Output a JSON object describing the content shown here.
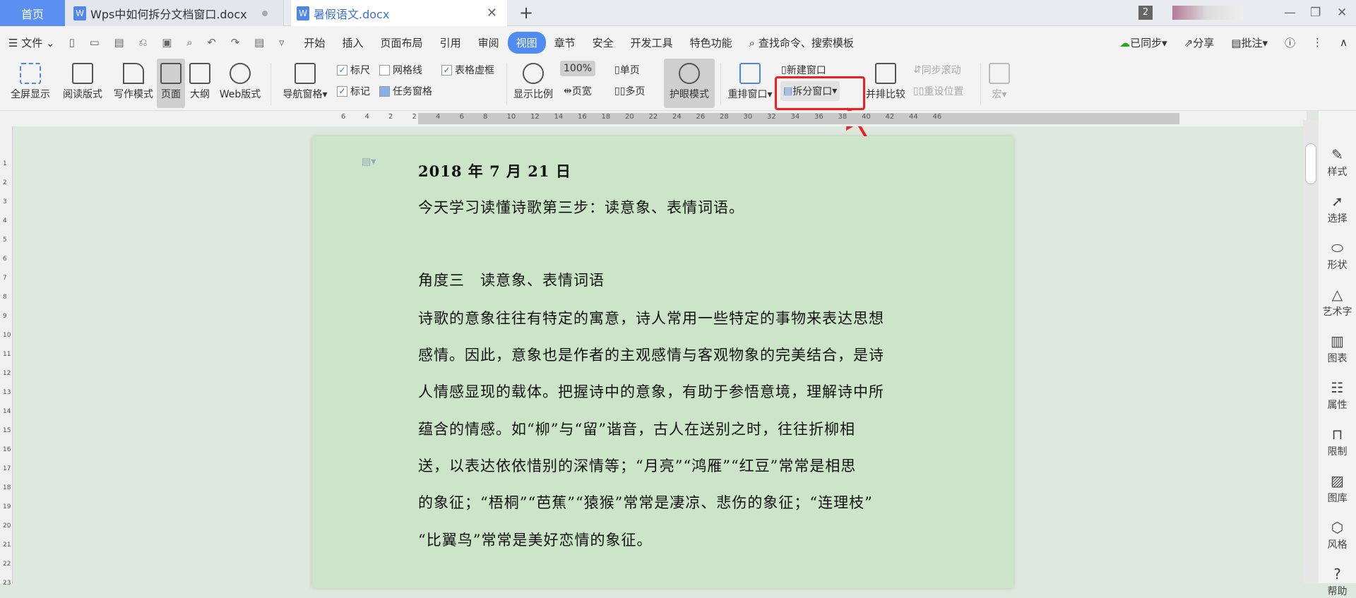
{
  "tabs": {
    "home": "首页",
    "doc1": "Wps中如何拆分文档窗口.docx",
    "doc2": "暑假语文.docx",
    "badge": "2"
  },
  "menu": {
    "file": "文件",
    "items": [
      "开始",
      "插入",
      "页面布局",
      "引用",
      "审阅",
      "视图",
      "章节",
      "安全",
      "开发工具",
      "特色功能"
    ],
    "active": "视图",
    "search": "查找命令、搜索模板",
    "sync": "已同步",
    "share": "分享",
    "comment": "批注"
  },
  "ribbon": {
    "fullscreen": "全屏显示",
    "read": "阅读版式",
    "write": "写作模式",
    "page": "页面",
    "outline": "大纲",
    "web": "Web版式",
    "nav": "导航窗格",
    "ruler": "标尺",
    "grid": "网格线",
    "tableframe": "表格虚框",
    "mark": "标记",
    "taskpane": "任务窗格",
    "zoom": "显示比例",
    "zoom_value": "100%",
    "single": "单页",
    "width": "页宽",
    "multi": "多页",
    "eye": "护眼模式",
    "rearrange": "重排窗口",
    "newwin": "新建窗口",
    "split": "拆分窗口",
    "compare": "并排比较",
    "syncscroll": "同步滚动",
    "resetpos": "重设位置",
    "macro": "宏"
  },
  "ruler_ticks": [
    "6",
    "4",
    "2",
    "2",
    "4",
    "6",
    "8",
    "10",
    "12",
    "14",
    "16",
    "18",
    "20",
    "22",
    "24",
    "26",
    "28",
    "30",
    "32",
    "34",
    "36",
    "38",
    "40",
    "42",
    "44",
    "46"
  ],
  "vruler_ticks": [
    "1",
    "2",
    "3",
    "4",
    "5",
    "6",
    "7",
    "8",
    "9",
    "10",
    "11",
    "12",
    "13",
    "14",
    "15",
    "16",
    "17",
    "18",
    "19",
    "20",
    "21",
    "22",
    "23"
  ],
  "document": {
    "lines": [
      "2018 年 7 月 21 日",
      "今天学习读懂诗歌第三步：读意象、表情词语。",
      "角度三　读意象、表情词语",
      "诗歌的意象往往有特定的寓意，诗人常用一些特定的事物来表达思想",
      "感情。因此，意象也是作者的主观感情与客观物象的完美结合，是诗",
      "人情感显现的载体。把握诗中的意象，有助于参悟意境，理解诗中所",
      "蕴含的情感。如“柳”与“留”谐音，古人在送别之时，往往折柳相",
      "送，以表达依依惜别的深情等；“月亮”“鸿雁”“红豆”常常是相思",
      "的象征；“梧桐”“芭蕉”“猿猴”常常是凄凉、悲伤的象征；“连理枝”",
      "“比翼鸟”常常是美好恋情的象征。"
    ]
  },
  "sidebar": [
    "样式",
    "选择",
    "形状",
    "艺术字",
    "图表",
    "属性",
    "限制",
    "图库",
    "风格",
    "帮助"
  ],
  "colors": {
    "accent": "#4f8bf0",
    "page": "#cce5c8",
    "highlight": "#f02020"
  }
}
